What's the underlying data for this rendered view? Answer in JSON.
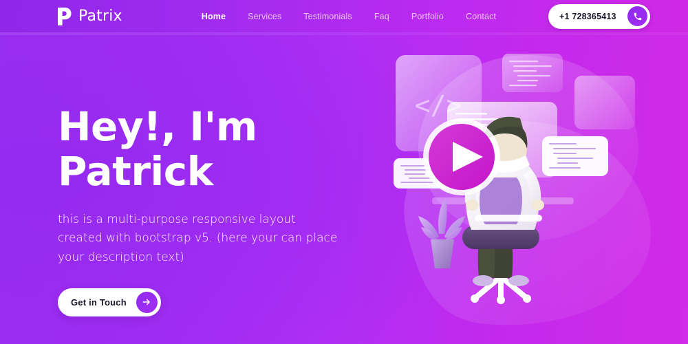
{
  "header": {
    "brand": {
      "name": "Patrix",
      "mark_letter": "P"
    },
    "nav": [
      {
        "label": "Home",
        "active": true
      },
      {
        "label": "Services",
        "active": false
      },
      {
        "label": "Testimonials",
        "active": false
      },
      {
        "label": "Faq",
        "active": false
      },
      {
        "label": "Portfolio",
        "active": false
      },
      {
        "label": "Contact",
        "active": false
      }
    ],
    "phone": {
      "number": "+1 728365413",
      "icon": "phone-icon"
    }
  },
  "hero": {
    "title_line1": "Hey!, I'm",
    "title_line2": "Patrick",
    "subtitle": "this is a multi-purpose responsive layout created with bootstrap v5. (here your can place your description text)",
    "cta": {
      "label": "Get in Touch",
      "icon": "arrow-right-icon"
    }
  },
  "illustration": {
    "code_card_glyph": "</>",
    "play_button_icon": "play-icon",
    "elements": [
      "blob-background",
      "code-card",
      "code-panel-top",
      "code-panel-right",
      "code-panel-center",
      "code-panel-left",
      "code-card-white",
      "play-button",
      "person-on-chair",
      "potted-plant",
      "desk-shadow"
    ]
  },
  "colors": {
    "bg_left": "#9a2df0",
    "bg_right": "#d22ae7",
    "header_left": "#8f27e8",
    "header_right": "#d029e6",
    "accent": "#8e2bf0",
    "play_magenta": "#cf1fd2",
    "white": "#ffffff",
    "text_dark": "#1a1a2e"
  }
}
